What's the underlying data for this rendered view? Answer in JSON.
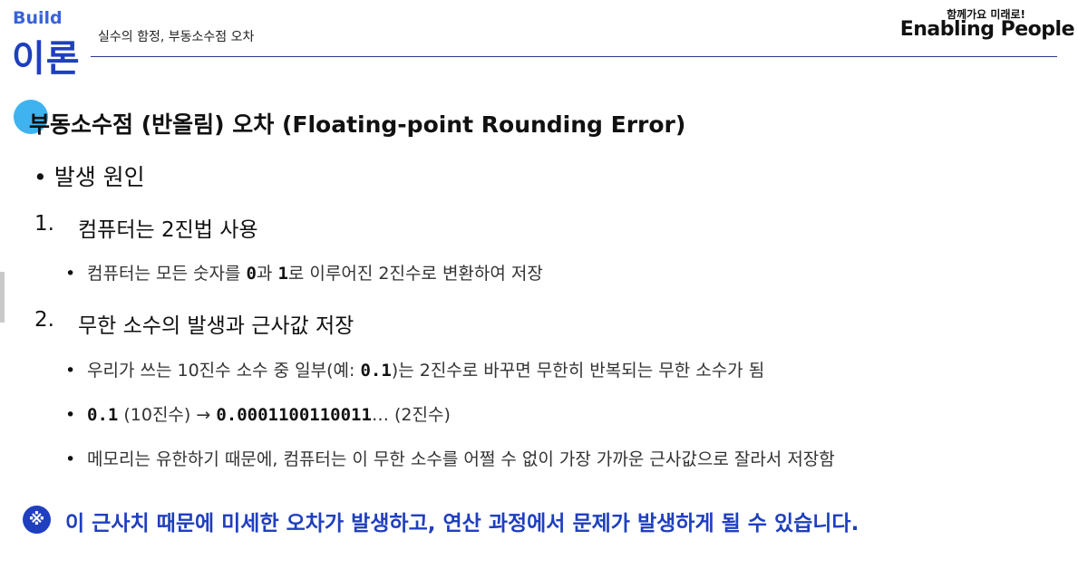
{
  "header": {
    "section_en": "Build",
    "section_ko": "이론",
    "subtitle": "실수의 함정, 부동소수점 오차",
    "logo_tagline": "함께가요 미래로!",
    "logo_name": "Enabling People"
  },
  "content": {
    "title": "부동소수점 (반올림) 오차 (Floating-point Rounding Error)",
    "bullet": "발생 원인",
    "items": [
      {
        "number": "1.",
        "label": "컴퓨터는 2진법 사용",
        "subs": [
          {
            "pre": "컴퓨터는 모든 숫자를 ",
            "code1": "0",
            "mid": "과 ",
            "code2": "1",
            "post": "로 이루어진 2진수로 변환하여 저장"
          }
        ]
      },
      {
        "number": "2.",
        "label": "무한 소수의 발생과 근사값 저장",
        "subs": [
          {
            "pre": "우리가 쓰는 10진수 소수 중 일부(예: ",
            "code1": "0.1",
            "post": ")는 2진수로 바꾸면 무한히 반복되는 무한 소수가 됨"
          },
          {
            "code1": "0.1",
            "mid": " (10진수) → ",
            "code2": "0.0001100110011",
            "post": "… (2진수)"
          },
          {
            "pre": "메모리는 유한하기 때문에, 컴퓨터는 이 무한 소수를 어쩔 수 없이 가장 가까운 근사값으로 잘라서 저장함"
          }
        ]
      }
    ],
    "note_icon": "※",
    "note": "이 근사치 때문에 미세한 오차가 발생하고, 연산 과정에서 문제가 발생하게 될 수 있습니다."
  },
  "colors": {
    "accent": "#1f3fbf",
    "title_dot": "#3fb3f0"
  }
}
